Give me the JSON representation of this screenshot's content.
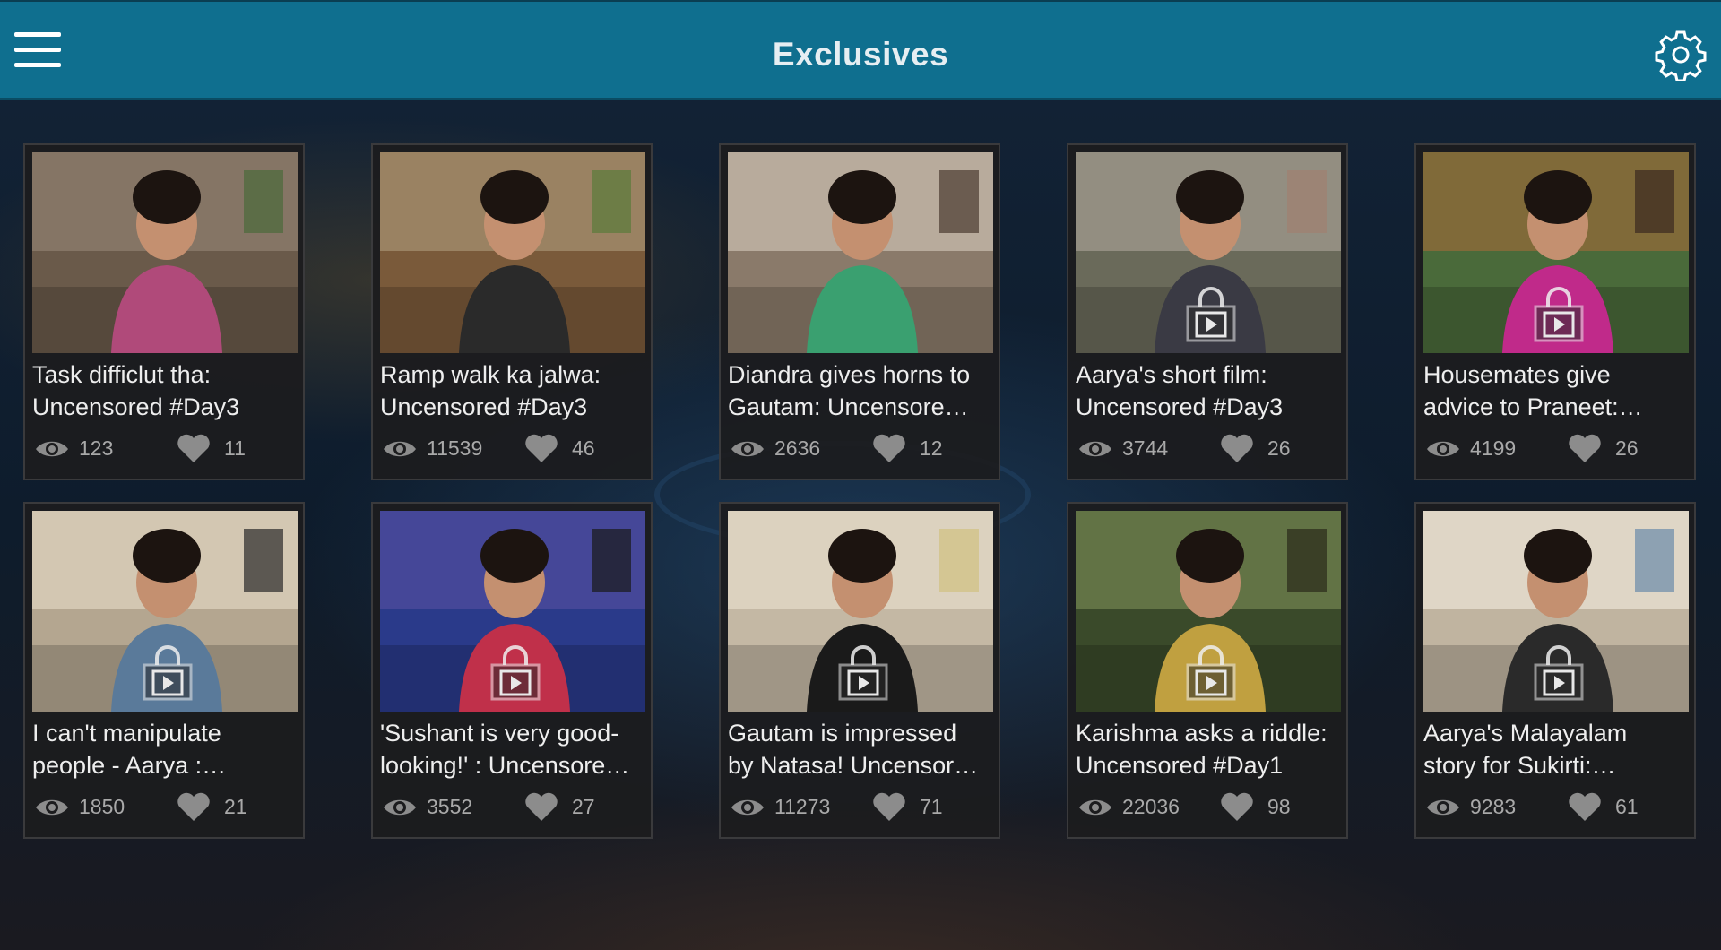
{
  "header": {
    "title": "Exclusives",
    "menu_icon": "hamburger-menu-icon",
    "settings_icon": "gear-icon",
    "bar_color": "#0f6f8f"
  },
  "videos": [
    {
      "title_line1": "Task difficlut tha:",
      "title_line2": "Uncensored #Day3",
      "views": "123",
      "likes": "11",
      "locked": false,
      "palette": [
        "#6a5a4a",
        "#8a7a6a",
        "#b04a7a",
        "#4a6a3a"
      ]
    },
    {
      "title_line1": "Ramp walk ka jalwa:",
      "title_line2": "Uncensored #Day3",
      "views": "11539",
      "likes": "46",
      "locked": false,
      "palette": [
        "#7a5a3a",
        "#a08a6a",
        "#2a2a2a",
        "#5a7a3a"
      ]
    },
    {
      "title_line1": "Diandra gives horns to",
      "title_line2": "Gautam: Uncensore…",
      "views": "2636",
      "likes": "12",
      "locked": false,
      "palette": [
        "#8a7a6a",
        "#c0b4a4",
        "#3aa070",
        "#4a3a30"
      ]
    },
    {
      "title_line1": "Aarya's short film:",
      "title_line2": "Uncensored #Day3",
      "views": "3744",
      "likes": "26",
      "locked": true,
      "palette": [
        "#6a6a5a",
        "#9a9488",
        "#3a3a44",
        "#a08070"
      ]
    },
    {
      "title_line1": "Housemates give",
      "title_line2": "advice to Praneet:…",
      "views": "4199",
      "likes": "26",
      "locked": true,
      "palette": [
        "#4a6a3a",
        "#8a6a3a",
        "#c02a8a",
        "#3a2a20"
      ]
    },
    {
      "title_line1": "I can't manipulate",
      "title_line2": "people - Aarya :…",
      "views": "1850",
      "likes": "21",
      "locked": true,
      "palette": [
        "#b4a690",
        "#d8ccb8",
        "#5a7a9a",
        "#2a2a2a"
      ]
    },
    {
      "title_line1": "'Sushant is very good-",
      "title_line2": "looking!' : Uncensore…",
      "views": "3552",
      "likes": "27",
      "locked": true,
      "palette": [
        "#2a3a8a",
        "#4a4a9a",
        "#c0304a",
        "#1a1a1a"
      ]
    },
    {
      "title_line1": "Gautam is impressed",
      "title_line2": "by Natasa! Uncensor…",
      "views": "11273",
      "likes": "71",
      "locked": true,
      "palette": [
        "#c4b8a4",
        "#e0d6c4",
        "#1a1a1a",
        "#d0c080"
      ]
    },
    {
      "title_line1": "Karishma asks a riddle:",
      "title_line2": "Uncensored #Day1",
      "views": "22036",
      "likes": "98",
      "locked": true,
      "palette": [
        "#3a4a2a",
        "#6a7a4a",
        "#c0a040",
        "#2a2a1a"
      ]
    },
    {
      "title_line1": "Aarya's Malayalam",
      "title_line2": "story for Sukirti:…",
      "views": "9283",
      "likes": "61",
      "locked": true,
      "palette": [
        "#c0b4a0",
        "#e4dccc",
        "#2a2a2a",
        "#6a8aaa"
      ]
    }
  ]
}
